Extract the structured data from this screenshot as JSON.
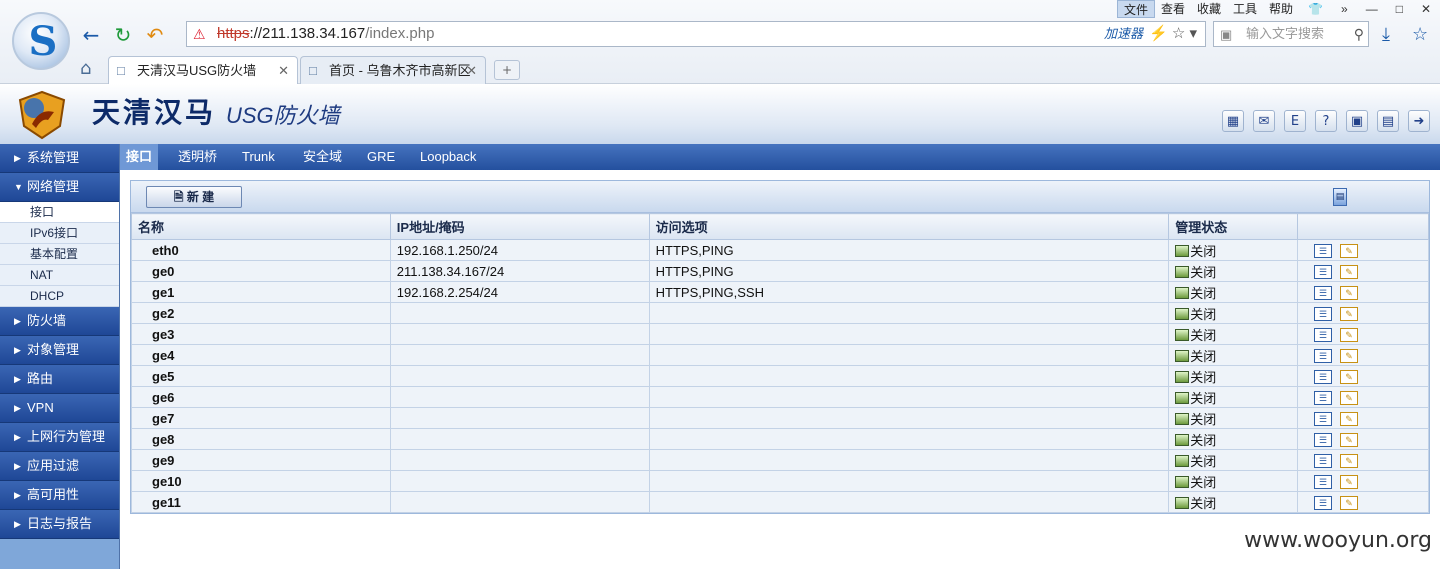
{
  "browser": {
    "menu": [
      "文件",
      "查看",
      "收藏",
      "工具",
      "帮助"
    ],
    "window_buttons": [
      "»",
      "—",
      "□",
      "✕"
    ],
    "address": {
      "protocol": "https",
      "host": "://211.138.34.167",
      "path": "/index.php"
    },
    "accelerator_label": "加速器",
    "search_placeholder": "输入文字搜索",
    "tabs": [
      {
        "label": "天清汉马USG防火墙",
        "active": true
      },
      {
        "label": "首页 - 乌鲁木齐市高新区",
        "active": false
      }
    ],
    "new_tab_label": "+"
  },
  "app": {
    "brand_cn": "天清汉马",
    "brand_product": "USG防火墙"
  },
  "sidebar": {
    "menus": [
      {
        "label": "系统管理",
        "expanded": false
      },
      {
        "label": "网络管理",
        "expanded": true,
        "children": [
          "接口",
          "IPv6接口",
          "基本配置",
          "NAT",
          "DHCP"
        ],
        "selected": "接口"
      },
      {
        "label": "防火墙",
        "expanded": false
      },
      {
        "label": "对象管理",
        "expanded": false
      },
      {
        "label": "路由",
        "expanded": false
      },
      {
        "label": "VPN",
        "expanded": false
      },
      {
        "label": "上网行为管理",
        "expanded": false
      },
      {
        "label": "应用过滤",
        "expanded": false
      },
      {
        "label": "高可用性",
        "expanded": false
      },
      {
        "label": "日志与报告",
        "expanded": false
      }
    ]
  },
  "subtabs": [
    "接口",
    "透明桥",
    "Trunk",
    "安全域",
    "GRE",
    "Loopback"
  ],
  "toolbar": {
    "new_label": "新 建"
  },
  "table": {
    "headers": [
      "名称",
      "IP地址/掩码",
      "访问选项",
      "管理状态",
      ""
    ],
    "rows": [
      {
        "name": "eth0",
        "ip": "192.168.1.250/24",
        "access": "HTTPS,PING",
        "status": "关闭"
      },
      {
        "name": "ge0",
        "ip": "211.138.34.167/24",
        "access": "HTTPS,PING",
        "status": "关闭"
      },
      {
        "name": "ge1",
        "ip": "192.168.2.254/24",
        "access": "HTTPS,PING,SSH",
        "status": "关闭"
      },
      {
        "name": "ge2",
        "ip": "",
        "access": "",
        "status": "关闭"
      },
      {
        "name": "ge3",
        "ip": "",
        "access": "",
        "status": "关闭"
      },
      {
        "name": "ge4",
        "ip": "",
        "access": "",
        "status": "关闭"
      },
      {
        "name": "ge5",
        "ip": "",
        "access": "",
        "status": "关闭"
      },
      {
        "name": "ge6",
        "ip": "",
        "access": "",
        "status": "关闭"
      },
      {
        "name": "ge7",
        "ip": "",
        "access": "",
        "status": "关闭"
      },
      {
        "name": "ge8",
        "ip": "",
        "access": "",
        "status": "关闭"
      },
      {
        "name": "ge9",
        "ip": "",
        "access": "",
        "status": "关闭"
      },
      {
        "name": "ge10",
        "ip": "",
        "access": "",
        "status": "关闭"
      },
      {
        "name": "ge11",
        "ip": "",
        "access": "",
        "status": "关闭"
      }
    ]
  },
  "watermark": "www.wooyun.org",
  "colors": {
    "nav_blue": "#24509e",
    "sidebar_blue": "#7fa7d9",
    "brand_navy": "#0d2a68"
  }
}
